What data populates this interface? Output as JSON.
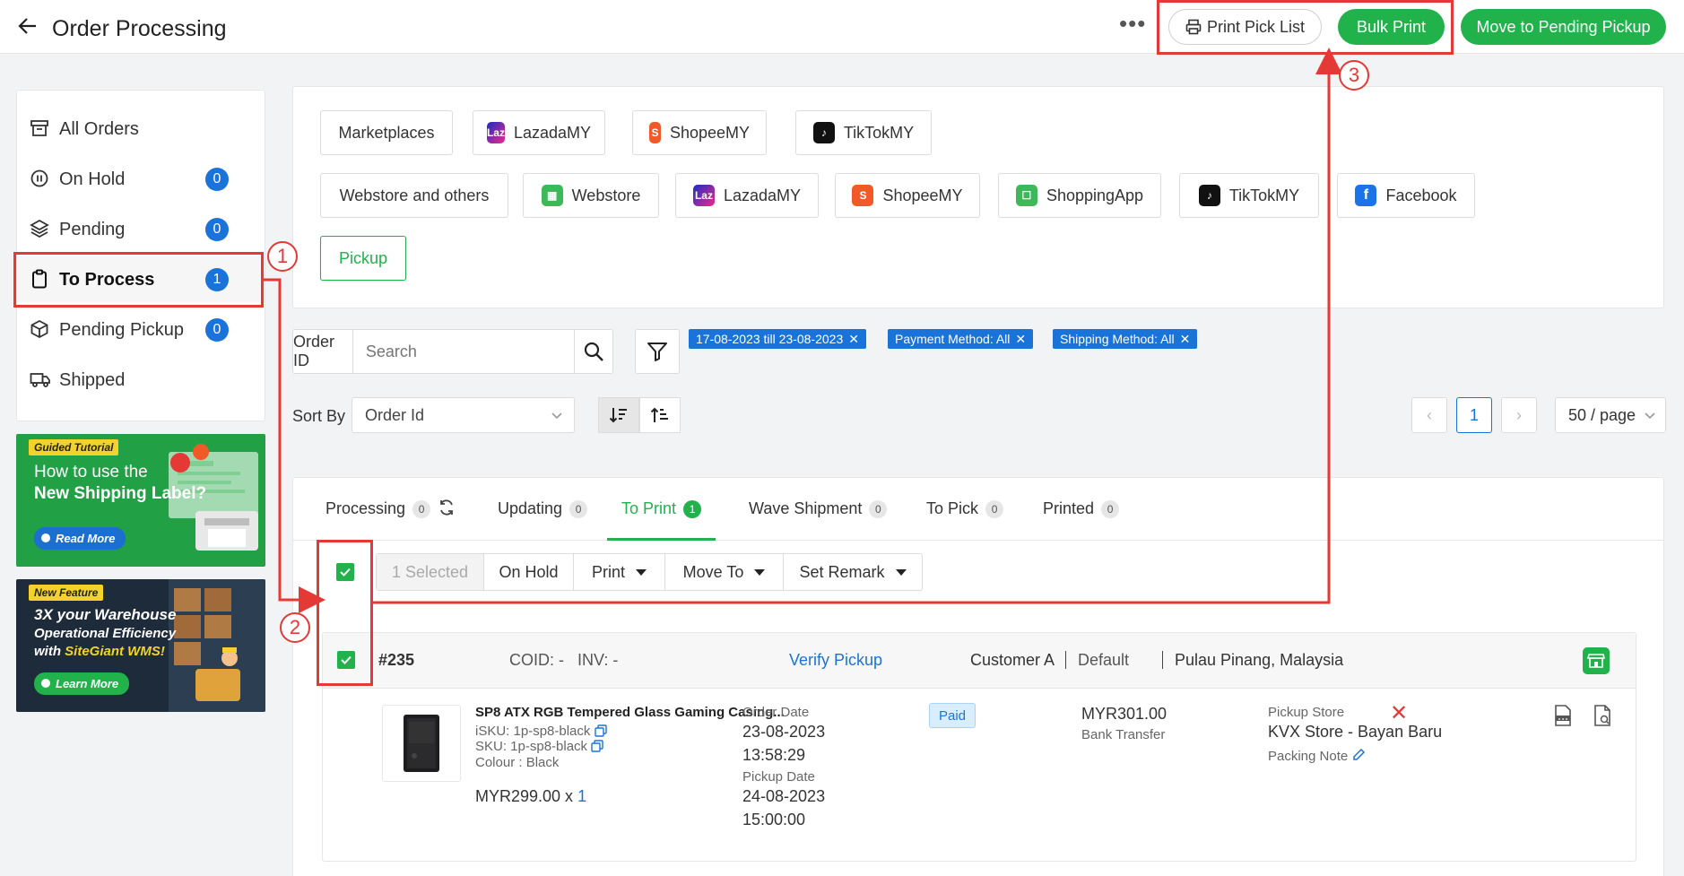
{
  "header": {
    "title": "Order Processing",
    "print_pick_list": "Print Pick List",
    "bulk_print": "Bulk Print",
    "move_pending": "Move to Pending Pickup",
    "more": "•••"
  },
  "sidebar": {
    "items": [
      {
        "label": "All Orders",
        "icon": "archive-icon"
      },
      {
        "label": "On Hold",
        "icon": "pause-icon",
        "count": "0"
      },
      {
        "label": "Pending",
        "icon": "layers-icon",
        "count": "0"
      },
      {
        "label": "To Process",
        "icon": "clipboard-icon",
        "count": "1"
      },
      {
        "label": "Pending Pickup",
        "icon": "box-icon",
        "count": "0"
      },
      {
        "label": "Shipped",
        "icon": "truck-icon"
      }
    ]
  },
  "promos": {
    "p1_tag": "Guided Tutorial",
    "p1_line1": "How to use the",
    "p1_line2": "New Shipping Label?",
    "p1_cta": "Read More",
    "p2_tag": "New Feature",
    "p2_line1": "3X your Warehouse",
    "p2_line2": "Operational Efficiency",
    "p2_line3_pre": "with ",
    "p2_line3_brand": "SiteGiant WMS!",
    "p2_cta": "Learn More"
  },
  "marketplaces": {
    "row1": [
      "Marketplaces",
      "LazadaMY",
      "ShopeeMY",
      "TikTokMY"
    ],
    "row2": [
      "Webstore and others",
      "Webstore",
      "LazadaMY",
      "ShopeeMY",
      "ShoppingApp",
      "TikTokMY",
      "Facebook"
    ],
    "pickup": "Pickup"
  },
  "search": {
    "label": "Order ID",
    "placeholder": "Search"
  },
  "filters": [
    "17-08-2023 till 23-08-2023",
    "Payment Method: All",
    "Shipping Method: All"
  ],
  "sort": {
    "label": "Sort By",
    "value": "Order Id"
  },
  "pager": {
    "page": "1",
    "per_page": "50 / page",
    "prev": "‹",
    "next": "›"
  },
  "tabs": [
    {
      "label": "Processing",
      "count": "0"
    },
    {
      "label": "Updating",
      "count": "0"
    },
    {
      "label": "To Print",
      "count": "1"
    },
    {
      "label": "Wave Shipment",
      "count": "0"
    },
    {
      "label": "To Pick",
      "count": "0"
    },
    {
      "label": "Printed",
      "count": "0"
    }
  ],
  "actions": {
    "selected": "1 Selected",
    "on_hold": "On Hold",
    "print": "Print",
    "move_to": "Move To",
    "set_remark": "Set Remark"
  },
  "order": {
    "number": "#235",
    "coid": "COID: -",
    "inv": "INV: -",
    "verify": "Verify Pickup",
    "customer": "Customer A",
    "address_type": "Default",
    "location": "Pulau Pinang, Malaysia",
    "product_name": "SP8 ATX RGB Tempered Glass Gaming Casing...",
    "isku": "iSKU: 1p-sp8-black",
    "sku": "SKU: 1p-sp8-black",
    "colour": "Colour : Black",
    "unit_price": "MYR299.00 x ",
    "qty": "1",
    "order_date_label": "Order Date",
    "order_date": "23-08-2023",
    "order_time": "13:58:29",
    "pickup_date_label": "Pickup Date",
    "pickup_date": "24-08-2023",
    "pickup_time": "15:00:00",
    "status": "Paid",
    "total": "MYR301.00",
    "payment": "Bank Transfer",
    "pickup_store_label": "Pickup Store",
    "pickup_store": "KVX Store - Bayan Baru",
    "packing_note": "Packing Note"
  },
  "annotations": [
    "1",
    "2",
    "3"
  ],
  "colors": {
    "accent_green": "#21b24b",
    "accent_blue": "#1a73d9",
    "annotation_red": "#e53935"
  }
}
